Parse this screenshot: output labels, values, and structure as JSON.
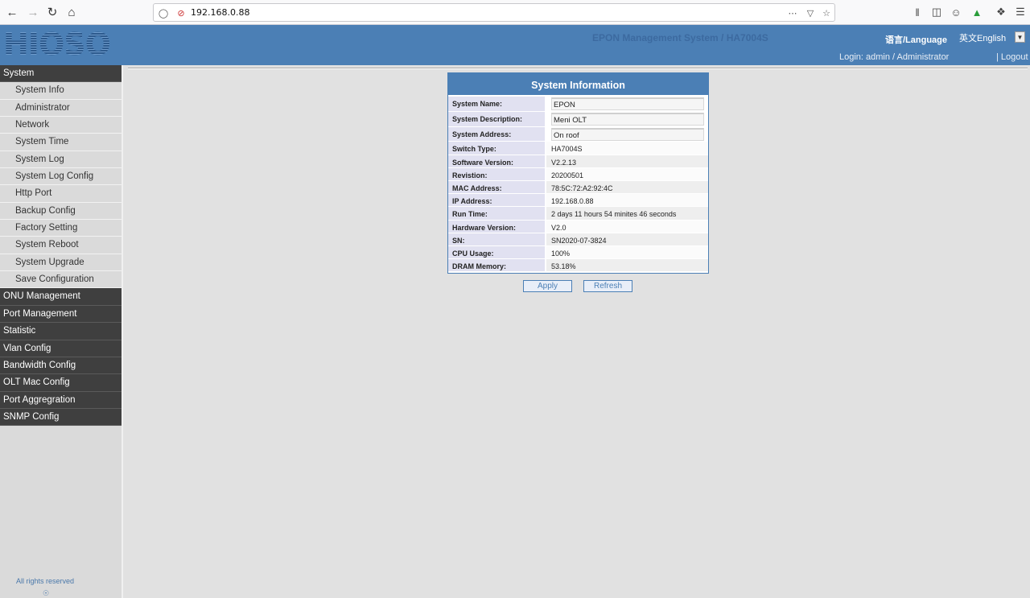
{
  "browser": {
    "url": "192.168.0.88"
  },
  "header": {
    "logo": "HIOSO",
    "title": "EPON Management System / HA7004S",
    "language_label": "语言/Language",
    "language_value": "英文English",
    "login": "Login: admin / Administrator",
    "logout": "| Logout"
  },
  "sidebar": {
    "items": [
      {
        "label": "System",
        "type": "category"
      },
      {
        "label": "System Info",
        "type": "item"
      },
      {
        "label": "Administrator",
        "type": "item"
      },
      {
        "label": "Network",
        "type": "item"
      },
      {
        "label": "System Time",
        "type": "item"
      },
      {
        "label": "System Log",
        "type": "item"
      },
      {
        "label": "System Log Config",
        "type": "item"
      },
      {
        "label": "Http Port",
        "type": "item"
      },
      {
        "label": "Backup Config",
        "type": "item"
      },
      {
        "label": "Factory Setting",
        "type": "item"
      },
      {
        "label": "System Reboot",
        "type": "item"
      },
      {
        "label": "System Upgrade",
        "type": "item"
      },
      {
        "label": "Save Configuration",
        "type": "item"
      },
      {
        "label": "ONU Management",
        "type": "category"
      },
      {
        "label": "Port Management",
        "type": "category"
      },
      {
        "label": "Statistic",
        "type": "category"
      },
      {
        "label": "Vlan Config",
        "type": "category"
      },
      {
        "label": "Bandwidth Config",
        "type": "category"
      },
      {
        "label": "OLT Mac Config",
        "type": "category"
      },
      {
        "label": "Port Aggregration",
        "type": "category"
      },
      {
        "label": "SNMP Config",
        "type": "category"
      }
    ],
    "footer": "All rights reserved"
  },
  "panel": {
    "title": "System Information",
    "rows": [
      {
        "label": "System Name:",
        "value": "EPON",
        "editable": true
      },
      {
        "label": "System Description:",
        "value": "Meni OLT",
        "editable": true
      },
      {
        "label": "System Address:",
        "value": "On roof",
        "editable": true
      },
      {
        "label": "Switch Type:",
        "value": "HA7004S"
      },
      {
        "label": "Software Version:",
        "value": "V2.2.13"
      },
      {
        "label": "Revistion:",
        "value": "20200501"
      },
      {
        "label": "MAC Address:",
        "value": "78:5C:72:A2:92:4C"
      },
      {
        "label": "IP Address:",
        "value": "192.168.0.88"
      },
      {
        "label": "Run Time:",
        "value": "2 days 11 hours 54 minites 46 seconds"
      },
      {
        "label": "Hardware Version:",
        "value": "V2.0"
      },
      {
        "label": "SN:",
        "value": "SN2020-07-3824"
      },
      {
        "label": "CPU Usage:",
        "value": "100%"
      },
      {
        "label": "DRAM Memory:",
        "value": "53.18%"
      }
    ]
  },
  "buttons": {
    "apply": "Apply",
    "refresh": "Refresh"
  }
}
